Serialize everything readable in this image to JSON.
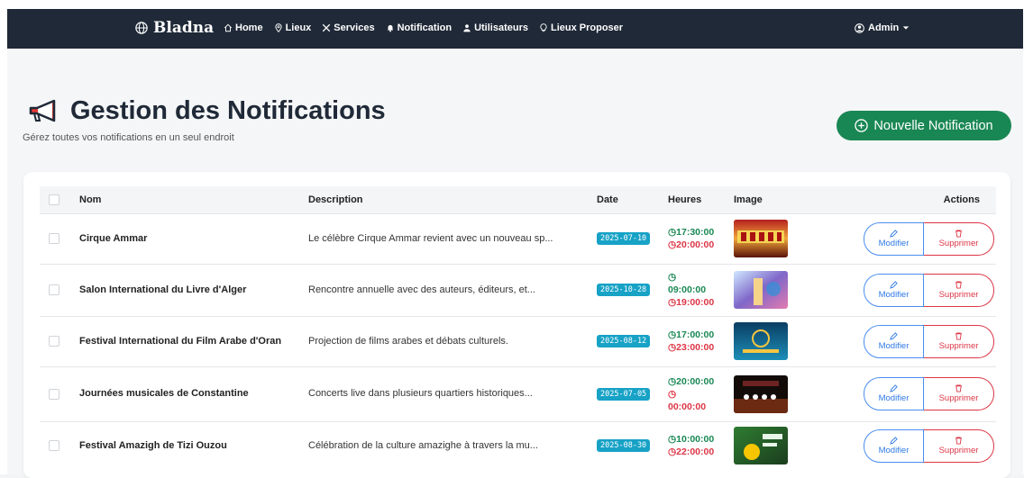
{
  "navbar": {
    "brand": "Bladna",
    "links": [
      {
        "label": "Home",
        "icon": "home-icon"
      },
      {
        "label": "Lieux",
        "icon": "map-pin-icon"
      },
      {
        "label": "Services",
        "icon": "tools-icon"
      },
      {
        "label": "Notification",
        "icon": "bell-icon"
      },
      {
        "label": "Utilisateurs",
        "icon": "user-icon"
      },
      {
        "label": "Lieux Proposer",
        "icon": "lightbulb-icon"
      }
    ],
    "admin_label": "Admin"
  },
  "header": {
    "title": "Gestion des Notifications",
    "subtitle": "Gérez toutes vos notifications en un seul endroit",
    "new_button": "Nouvelle Notification"
  },
  "table": {
    "columns": [
      "Nom",
      "Description",
      "Date",
      "Heures",
      "Image",
      "Actions"
    ],
    "modify_label": "Modifier",
    "delete_label": "Supprimer",
    "rows": [
      {
        "name": "Cirque Ammar",
        "description": "Le célèbre Cirque Ammar revient avec un nouveau sp...",
        "date": "2025-07-10",
        "start": "17:30:00",
        "end": "20:00:00"
      },
      {
        "name": "Salon International du Livre d'Alger",
        "description": "Rencontre annuelle avec des auteurs, éditeurs, et...",
        "date": "2025-10-28",
        "start": "09:00:00",
        "end": "19:00:00"
      },
      {
        "name": "Festival International du Film Arabe d'Oran",
        "description": "Projection de films arabes et débats culturels.",
        "date": "2025-08-12",
        "start": "17:00:00",
        "end": "23:00:00"
      },
      {
        "name": "Journées musicales de Constantine",
        "description": "Concerts live dans plusieurs quartiers historiques...",
        "date": "2025-07-05",
        "start": "20:00:00",
        "end": "00:00:00"
      },
      {
        "name": "Festival Amazigh de Tizi Ouzou",
        "description": "Célébration de la culture amazighe à travers la mu...",
        "date": "2025-08-30",
        "start": "10:00:00",
        "end": "22:00:00"
      }
    ]
  },
  "colors": {
    "navbar": "#1f2937",
    "primary_green": "#198754",
    "date_badge": "#17a2c6",
    "danger": "#dc3545",
    "info_blue": "#2f7ae5"
  }
}
